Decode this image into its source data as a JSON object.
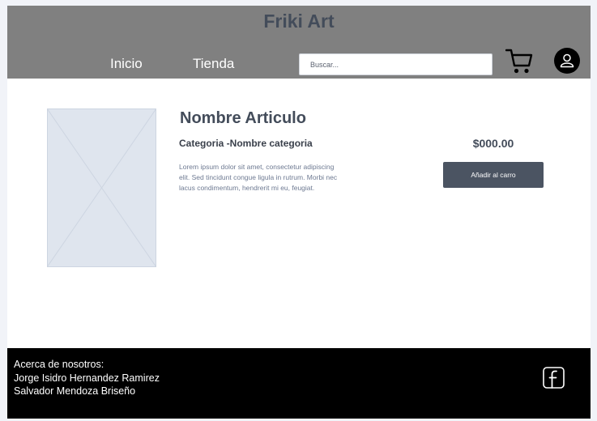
{
  "header": {
    "title": "Friki Art",
    "nav": {
      "home_label": "Inicio",
      "store_label": "Tienda"
    },
    "search": {
      "placeholder": "Buscar...",
      "value": ""
    },
    "icons": {
      "cart": "cart-icon",
      "user": "user-icon"
    }
  },
  "product": {
    "name": "Nombre Articulo",
    "category": "Categoria -Nombre categoria",
    "description": "Lorem ipsum dolor sit amet, consectetur adipiscing elit. Sed tincidunt congue ligula in rutrum. Morbi nec lacus condimentum, hendrerit mi eu, feugiat.",
    "price": "$000.00",
    "add_to_cart_label": "Añadir al carro",
    "image_icon": "image-placeholder-icon"
  },
  "footer": {
    "about_label": "Acerca de nosotros:",
    "authors": [
      "Jorge Isidro Hernandez Ramirez",
      "Salvador Mendoza Briseño"
    ],
    "social_icon": "facebook-icon"
  },
  "colors": {
    "header_bg": "#808080",
    "title_text": "#434c5a",
    "button_bg": "#4b5462",
    "footer_bg": "#000000",
    "image_placeholder": "#dfe5ee"
  }
}
